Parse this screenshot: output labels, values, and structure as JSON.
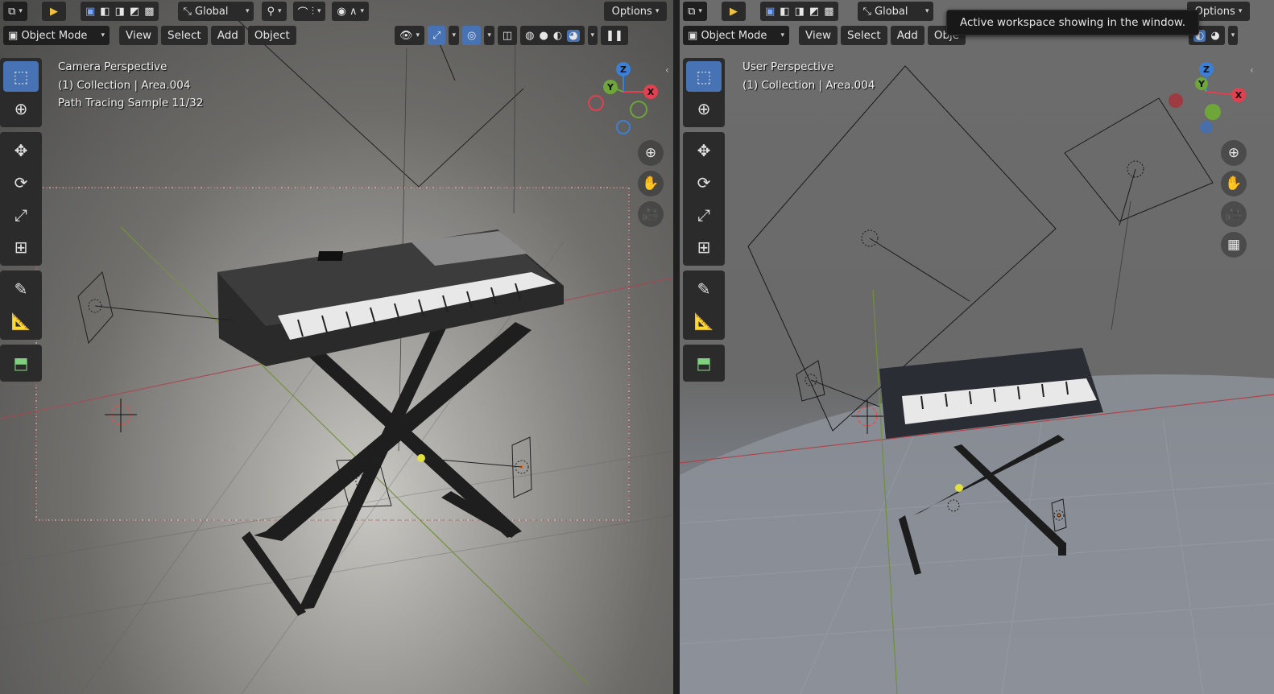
{
  "left_viewport": {
    "header": {
      "transform_orientation": "Global",
      "options_label": "Options",
      "mode_label": "Object Mode",
      "menus": [
        "View",
        "Select",
        "Add",
        "Object"
      ]
    },
    "info": {
      "line1": "Camera Perspective",
      "line2": "(1) Collection | Area.004",
      "line3": "Path Tracing Sample 11/32"
    },
    "gizmo": {
      "z": "Z",
      "y": "Y",
      "x": "X"
    }
  },
  "right_viewport": {
    "header": {
      "transform_orientation": "Global",
      "options_label": "Options",
      "mode_label": "Object Mode",
      "menus": [
        "View",
        "Select",
        "Add",
        "Obje"
      ]
    },
    "info": {
      "line1": "User Perspective",
      "line2": "(1) Collection | Area.004"
    },
    "gizmo": {
      "z": "Z",
      "y": "Y",
      "x": "X"
    }
  },
  "tooltip": "Active workspace showing in the window.",
  "colors": {
    "accent": "#4772b3",
    "axis_x": "#e0404f",
    "axis_y": "#6ea63a",
    "axis_z": "#3b7fd6",
    "header_bg": "#2a2a2a"
  },
  "icons": [
    "editor-type-icon",
    "select-tool-icon",
    "select-box-icon",
    "select-extend-icon",
    "select-subtract-icon",
    "select-invert-icon",
    "select-intersect-icon",
    "transform-orientation-icon",
    "pivot-icon",
    "snap-icon",
    "snap-target-icon",
    "proportional-edit-icon",
    "falloff-icon",
    "visibility-icon",
    "gizmo-icon",
    "overlay-icon",
    "xray-icon",
    "wireframe-icon",
    "solid-icon",
    "material-icon",
    "rendered-icon",
    "pause-icon",
    "cursor-tool-icon",
    "move-tool-icon",
    "rotate-tool-icon",
    "scale-tool-icon",
    "transform-tool-icon",
    "annotate-tool-icon",
    "measure-tool-icon",
    "add-cube-tool-icon",
    "zoom-icon",
    "pan-hand-icon",
    "camera-view-icon",
    "ortho-grid-icon"
  ]
}
